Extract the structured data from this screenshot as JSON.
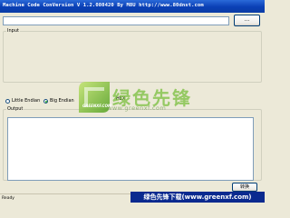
{
  "window": {
    "title": "Machine Code ConVersion V 1.2.080420 By M8U http://www.80dnst.com"
  },
  "toolbar": {
    "path_value": "",
    "browse_label": "..."
  },
  "input_group": {
    "legend": "Input"
  },
  "endian": {
    "options": [
      {
        "label": "Little Endian",
        "selected": false
      },
      {
        "label": "Big Endian",
        "selected": true
      }
    ],
    "hex_label": "HEX"
  },
  "output_group": {
    "legend": "Output"
  },
  "actions": {
    "convert_label": "转换"
  },
  "statusbar": {
    "text": "Ready"
  },
  "watermark": {
    "brand": "绿色先锋",
    "url": "www.greenxf.com",
    "logo_text": "GREENXF.COM",
    "footer": "绿色先锋下载(www.greenxf.com)"
  },
  "colors": {
    "titlebar": "#0a3fb5",
    "window_bg": "#ece9d8",
    "selected_radio": "#21a121"
  }
}
